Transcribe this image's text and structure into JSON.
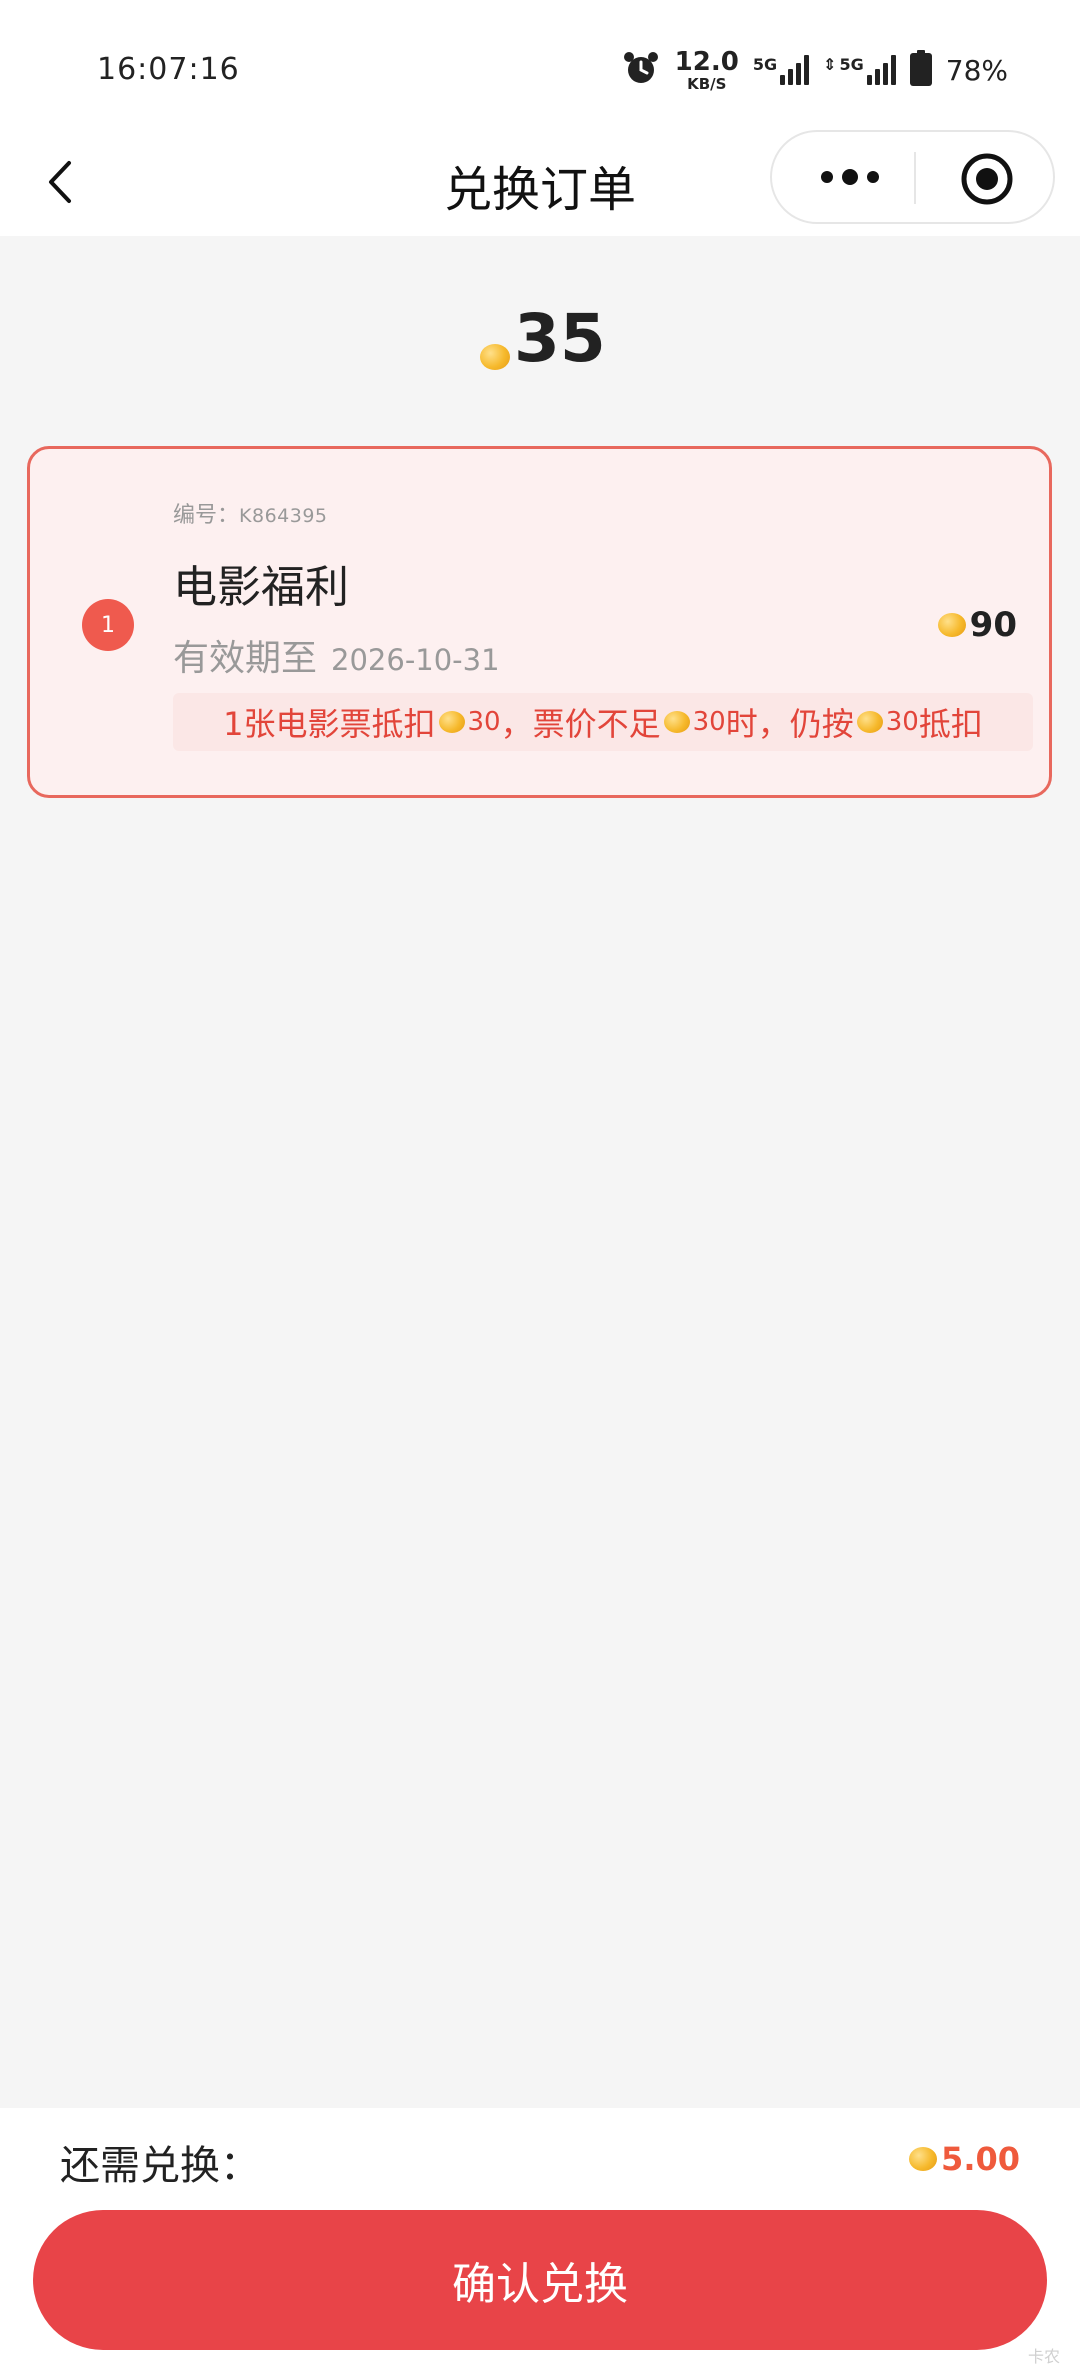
{
  "status_bar": {
    "time": "16:07:16",
    "net_speed_value": "12.0",
    "net_speed_unit": "KB/S",
    "signal_1_label": "5G",
    "signal_2_label": "5G",
    "battery_percent": "78%"
  },
  "nav": {
    "title": "兑换订单"
  },
  "balance": {
    "value": "35"
  },
  "items": [
    {
      "index": "1",
      "code_label": "编号：",
      "code": "K864395",
      "title": "电影福利",
      "expiry_label": "有效期至",
      "expiry_date": "2026-10-31",
      "price": "90",
      "rule": {
        "p1": "1张电影票抵扣",
        "n1": "30",
        "p2": "，票价不足",
        "n2": "30",
        "p3": "时，仍按",
        "n3": "30",
        "p4": "抵扣"
      }
    }
  ],
  "footer": {
    "remaining_label": "还需兑换：",
    "remaining_amount": "5.00",
    "confirm_label": "确认兑换"
  },
  "watermark": "卡农"
}
